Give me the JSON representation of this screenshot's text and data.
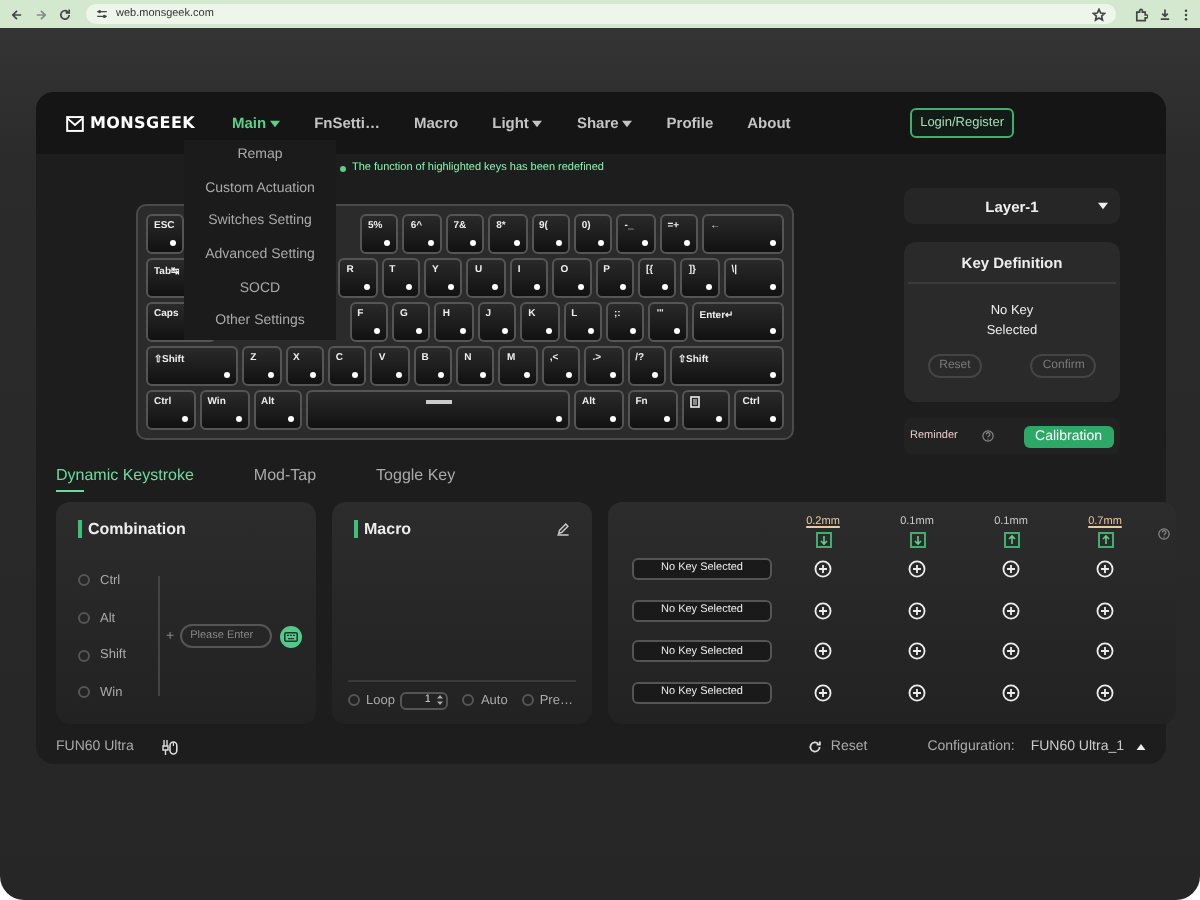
{
  "browser": {
    "url": "web.monsgeek.com"
  },
  "header": {
    "logo": "MONSGEEK",
    "nav": [
      {
        "label": "Main",
        "dropdown": true,
        "selected": true
      },
      {
        "label": "FnSetti…",
        "dropdown": false,
        "selected": false
      },
      {
        "label": "Macro",
        "dropdown": false,
        "selected": false
      },
      {
        "label": "Light",
        "dropdown": true,
        "selected": false
      },
      {
        "label": "Share",
        "dropdown": true,
        "selected": false
      },
      {
        "label": "Profile",
        "dropdown": false,
        "selected": false
      },
      {
        "label": "About",
        "dropdown": false,
        "selected": false
      }
    ],
    "login": "Login/Register"
  },
  "main_menu": [
    "Remap",
    "Custom Actuation",
    "Switches Setting",
    "Advanced Setting",
    "SOCD",
    "Other Settings"
  ],
  "notice": "The function of highlighted keys has been redefined",
  "keyboard": {
    "rows": [
      [
        {
          "kind": "key",
          "label": "ESC"
        },
        {
          "kind": "covered"
        },
        {
          "kind": "covered"
        },
        {
          "kind": "covered"
        },
        {
          "kind": "covered"
        },
        {
          "kind": "key",
          "label": "5%"
        },
        {
          "kind": "key",
          "label": "6^"
        },
        {
          "kind": "key",
          "label": "7&"
        },
        {
          "kind": "key",
          "label": "8*"
        },
        {
          "kind": "key",
          "label": "9("
        },
        {
          "kind": "key",
          "label": "0)"
        },
        {
          "kind": "key",
          "label": "-_"
        },
        {
          "kind": "key",
          "label": "=+"
        },
        {
          "kind": "key",
          "label": "←"
        }
      ],
      [
        {
          "kind": "key",
          "label": "Tab↹"
        },
        {
          "kind": "covered"
        },
        {
          "kind": "covered"
        },
        {
          "kind": "covered"
        },
        {
          "kind": "key",
          "label": "R"
        },
        {
          "kind": "key",
          "label": "T"
        },
        {
          "kind": "key",
          "label": "Y"
        },
        {
          "kind": "key",
          "label": "U"
        },
        {
          "kind": "key",
          "label": "I"
        },
        {
          "kind": "key",
          "label": "O"
        },
        {
          "kind": "key",
          "label": "P"
        },
        {
          "kind": "key",
          "label": "[{"
        },
        {
          "kind": "key",
          "label": "]}"
        },
        {
          "kind": "key",
          "label": "\\|"
        }
      ],
      [
        {
          "kind": "key",
          "label": "Caps"
        },
        {
          "kind": "covered"
        },
        {
          "kind": "covered"
        },
        {
          "kind": "covered"
        },
        {
          "kind": "key",
          "label": "F"
        },
        {
          "kind": "key",
          "label": "G"
        },
        {
          "kind": "key",
          "label": "H"
        },
        {
          "kind": "key",
          "label": "J"
        },
        {
          "kind": "key",
          "label": "K"
        },
        {
          "kind": "key",
          "label": "L"
        },
        {
          "kind": "key",
          "label": ";:"
        },
        {
          "kind": "key",
          "label": "'\""
        },
        {
          "kind": "key",
          "label": "Enter↵"
        }
      ],
      [
        {
          "kind": "key",
          "label": "⇧Shift"
        },
        {
          "kind": "key",
          "label": "Z"
        },
        {
          "kind": "key",
          "label": "X"
        },
        {
          "kind": "key",
          "label": "C"
        },
        {
          "kind": "key",
          "label": "V"
        },
        {
          "kind": "key",
          "label": "B"
        },
        {
          "kind": "key",
          "label": "N"
        },
        {
          "kind": "key",
          "label": "M"
        },
        {
          "kind": "key",
          "label": ",<"
        },
        {
          "kind": "key",
          "label": ".>"
        },
        {
          "kind": "key",
          "label": "/?"
        },
        {
          "kind": "key",
          "label": "⇧Shift"
        }
      ],
      [
        {
          "kind": "key",
          "label": "Ctrl"
        },
        {
          "kind": "key",
          "label": "Win"
        },
        {
          "kind": "key",
          "label": "Alt"
        },
        {
          "kind": "space"
        },
        {
          "kind": "key",
          "label": "Alt"
        },
        {
          "kind": "key",
          "label": "Fn"
        },
        {
          "kind": "menu"
        },
        {
          "kind": "key",
          "label": "Ctrl"
        }
      ]
    ]
  },
  "layer": {
    "value": "Layer-1"
  },
  "key_definition": {
    "title": "Key Definition",
    "message": "No Key Selected",
    "buttons": [
      {
        "label": "Reset",
        "disabled": true
      },
      {
        "label": "Confirm",
        "disabled": true
      }
    ]
  },
  "reminder": {
    "label": "Reminder",
    "button": "Calibration"
  },
  "tabs": [
    {
      "label": "Dynamic Keystroke",
      "selected": true
    },
    {
      "label": "Mod-Tap",
      "selected": false
    },
    {
      "label": "Toggle Key",
      "selected": false
    }
  ],
  "combination": {
    "title": "Combination",
    "modifiers": [
      {
        "label": "Ctrl",
        "checked": false
      },
      {
        "label": "Alt",
        "checked": false
      },
      {
        "label": "Shift",
        "checked": false
      },
      {
        "label": "Win",
        "checked": false
      }
    ],
    "plus": "+",
    "placeholder": "Please Enter"
  },
  "macro": {
    "title": "Macro",
    "options": [
      {
        "kind": "count",
        "label": "Loop",
        "checked": false,
        "value": "1"
      },
      {
        "kind": "radio",
        "label": "Auto",
        "checked": false
      },
      {
        "kind": "radio",
        "label": "Pre…",
        "checked": false
      }
    ]
  },
  "table": {
    "columns": [
      {
        "label": "0.2mm",
        "highlighted": true,
        "kind": "press"
      },
      {
        "label": "0.1mm",
        "highlighted": false,
        "kind": "press"
      },
      {
        "label": "0.1mm",
        "highlighted": false,
        "kind": "release"
      },
      {
        "label": "0.7mm",
        "highlighted": true,
        "kind": "release"
      }
    ],
    "rows": [
      {
        "key": "No Key Selected"
      },
      {
        "key": "No Key Selected"
      },
      {
        "key": "No Key Selected"
      },
      {
        "key": "No Key Selected"
      }
    ]
  },
  "footer": {
    "device": "FUN60 Ultra",
    "reset": "Reset",
    "config_label": "Configuration:",
    "config_value": "FUN60 Ultra_1"
  }
}
